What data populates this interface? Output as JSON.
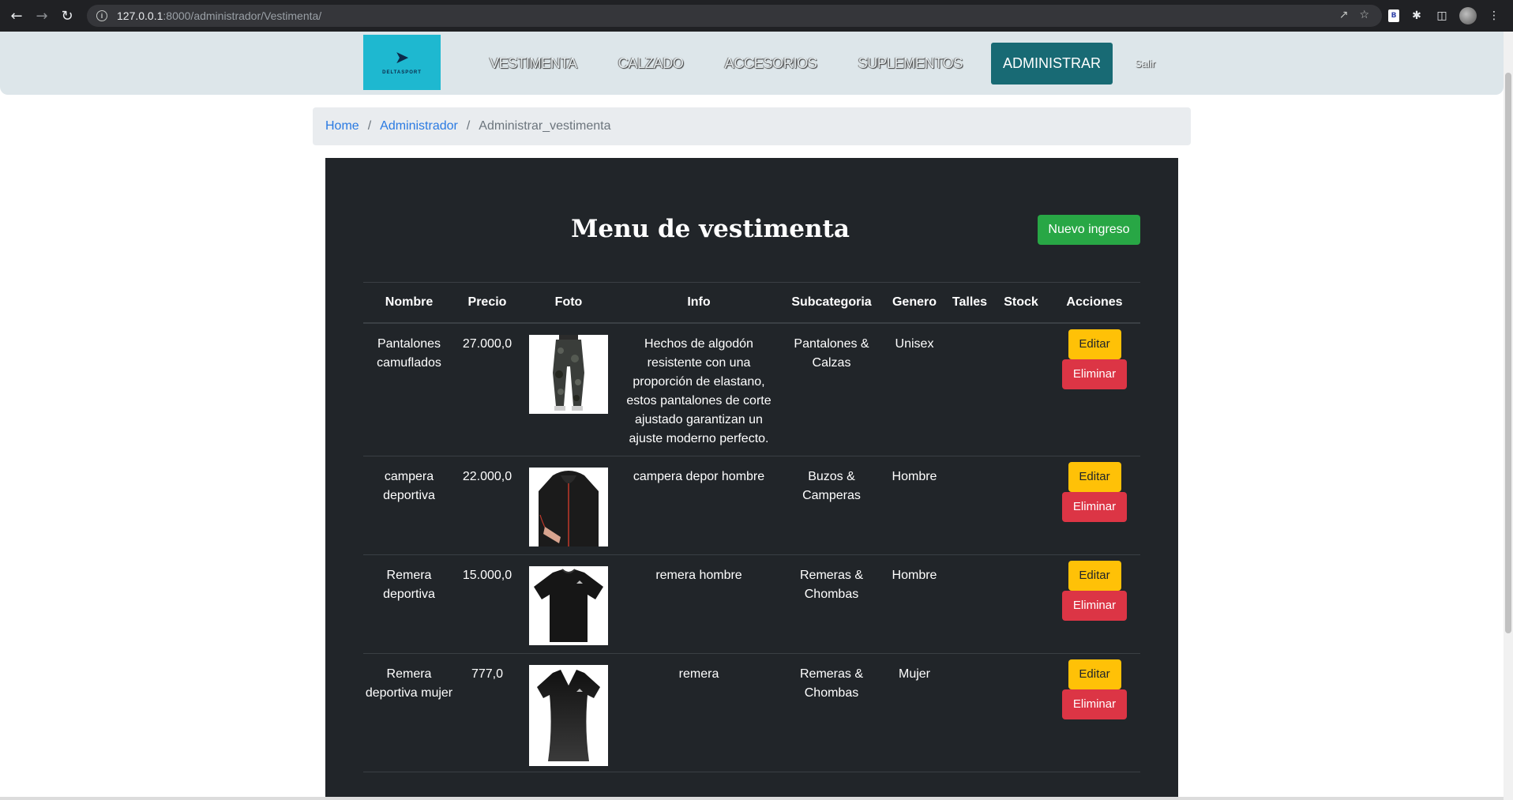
{
  "browser": {
    "url_host": "127.0.0.1",
    "url_path": ":8000/administrador/Vestimenta/"
  },
  "site": {
    "logo_text": "DELTASPORT",
    "nav": [
      "VESTIMENTA",
      "CALZADO",
      "ACCESORIOS",
      "SUPLEMENTOS"
    ],
    "nav_active": "ADMINISTRAR",
    "logout": "Salir"
  },
  "breadcrumb": {
    "home": "Home",
    "admin": "Administrador",
    "current": "Administrar_vestimenta"
  },
  "panel": {
    "title": "Menu de vestimenta",
    "new_button": "Nuevo ingreso"
  },
  "table": {
    "headers": [
      "Nombre",
      "Precio",
      "Foto",
      "Info",
      "Subcategoria",
      "Genero",
      "Talles",
      "Stock",
      "Acciones"
    ],
    "edit_label": "Editar",
    "delete_label": "Eliminar",
    "rows": [
      {
        "nombre": "Pantalones camuflados",
        "precio": "27.000,0",
        "foto": "camo-pants-photo",
        "info": "Hechos de algodón resistente con una proporción de elastano, estos pantalones de corte ajustado garantizan un ajuste moderno perfecto.",
        "subcategoria": "Pantalones & Calzas",
        "genero": "Unisex",
        "talles": "",
        "stock": ""
      },
      {
        "nombre": "campera deportiva",
        "precio": "22.000,0",
        "foto": "sport-jacket-photo",
        "info": "campera depor hombre",
        "subcategoria": "Buzos & Camperas",
        "genero": "Hombre",
        "talles": "",
        "stock": ""
      },
      {
        "nombre": "Remera deportiva",
        "precio": "15.000,0",
        "foto": "black-tshirt-photo",
        "info": "remera hombre",
        "subcategoria": "Remeras & Chombas",
        "genero": "Hombre",
        "talles": "",
        "stock": ""
      },
      {
        "nombre": "Remera deportiva mujer",
        "precio": "777,0",
        "foto": "womens-tshirt-photo",
        "info": "remera",
        "subcategoria": "Remeras & Chombas",
        "genero": "Mujer",
        "talles": "",
        "stock": ""
      }
    ]
  },
  "colors": {
    "panel_bg": "#212529",
    "nav_active_bg": "#186a74",
    "btn_new": "#28a745",
    "btn_edit": "#ffc107",
    "btn_delete": "#dc3545",
    "logo_bg": "#1eb8d0"
  }
}
